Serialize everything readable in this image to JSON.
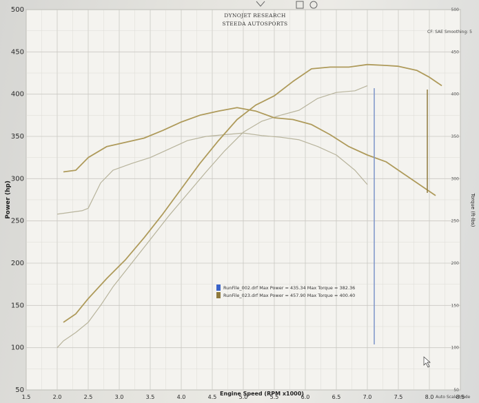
{
  "header": {
    "line1": "DYNOJET RESEARCH",
    "line2": "STEEDA AUTOSPORTS",
    "correction": "CF: SAE  Smoothing: 5"
  },
  "footer": {
    "brand": "Auto Scale Mode"
  },
  "chart_data": {
    "type": "line",
    "xlabel": "Engine Speed (RPM x1000)",
    "ylabel": "Power (hp)",
    "y2label": "Torque (ft-lbs)",
    "xlim": [
      1.5,
      8.5
    ],
    "ylim": [
      50,
      500
    ],
    "xticks": [
      "1.5",
      "2.0",
      "2.5",
      "3.0",
      "3.5",
      "4.0",
      "4.5",
      "5.0",
      "5.5",
      "6.0",
      "6.5",
      "7.0",
      "7.5",
      "8.0",
      "8.5"
    ],
    "yticks": [
      "50",
      "100",
      "150",
      "200",
      "250",
      "300",
      "350",
      "400",
      "450",
      "500"
    ],
    "y2ticks": [
      "50",
      "100",
      "150",
      "200",
      "250",
      "300",
      "350",
      "400",
      "450",
      "500"
    ],
    "grid": true,
    "legend": [
      {
        "text": "RunFile_002.drf Max Power = 435.34 Max Torque = 382.36",
        "color": "#3a63c9"
      },
      {
        "text": "RunFile_023.drf Max Power = 457.90 Max Torque = 400.40",
        "color": "#8e7a3d"
      }
    ],
    "series": [
      {
        "color": "#b7b39b",
        "x": [
          2.0,
          2.1,
          2.3,
          2.5,
          2.7,
          2.9,
          3.2,
          3.5,
          3.8,
          4.1,
          4.4,
          4.7,
          5.0,
          5.3,
          5.6,
          5.9,
          6.2,
          6.5,
          6.8,
          7.0
        ],
        "y": [
          100,
          108,
          118,
          130,
          150,
          172,
          200,
          228,
          256,
          282,
          308,
          333,
          355,
          368,
          375,
          381,
          395,
          402,
          404,
          410
        ]
      },
      {
        "color": "#b7b39b",
        "x": [
          2.0,
          2.2,
          2.4,
          2.5,
          2.7,
          2.9,
          3.2,
          3.5,
          3.8,
          4.1,
          4.4,
          4.7,
          5.0,
          5.3,
          5.6,
          5.9,
          6.2,
          6.5,
          6.8,
          7.0
        ],
        "y": [
          258,
          260,
          262,
          265,
          295,
          310,
          318,
          325,
          335,
          345,
          350,
          352,
          354,
          351,
          349,
          346,
          338,
          328,
          310,
          293
        ]
      },
      {
        "color": "#ae9a5a",
        "x": [
          2.1,
          2.3,
          2.5,
          2.8,
          3.1,
          3.4,
          3.7,
          4.0,
          4.3,
          4.6,
          4.9,
          5.2,
          5.5,
          5.8,
          6.1,
          6.4,
          6.7,
          7.0,
          7.3,
          7.5,
          7.8,
          8.0,
          8.2
        ],
        "y": [
          130,
          140,
          158,
          182,
          204,
          230,
          258,
          288,
          318,
          345,
          370,
          387,
          398,
          415,
          430,
          432,
          432,
          435,
          434,
          433,
          428,
          420,
          410
        ]
      },
      {
        "color": "#ae9a5a",
        "x": [
          2.1,
          2.3,
          2.5,
          2.8,
          3.1,
          3.4,
          3.7,
          4.0,
          4.3,
          4.6,
          4.9,
          5.2,
          5.5,
          5.8,
          6.1,
          6.4,
          6.7,
          7.0,
          7.3,
          7.6,
          7.9,
          8.1
        ],
        "y": [
          308,
          310,
          325,
          338,
          343,
          348,
          357,
          367,
          375,
          380,
          384,
          380,
          372,
          370,
          364,
          352,
          338,
          328,
          320,
          305,
          290,
          280
        ]
      }
    ]
  }
}
